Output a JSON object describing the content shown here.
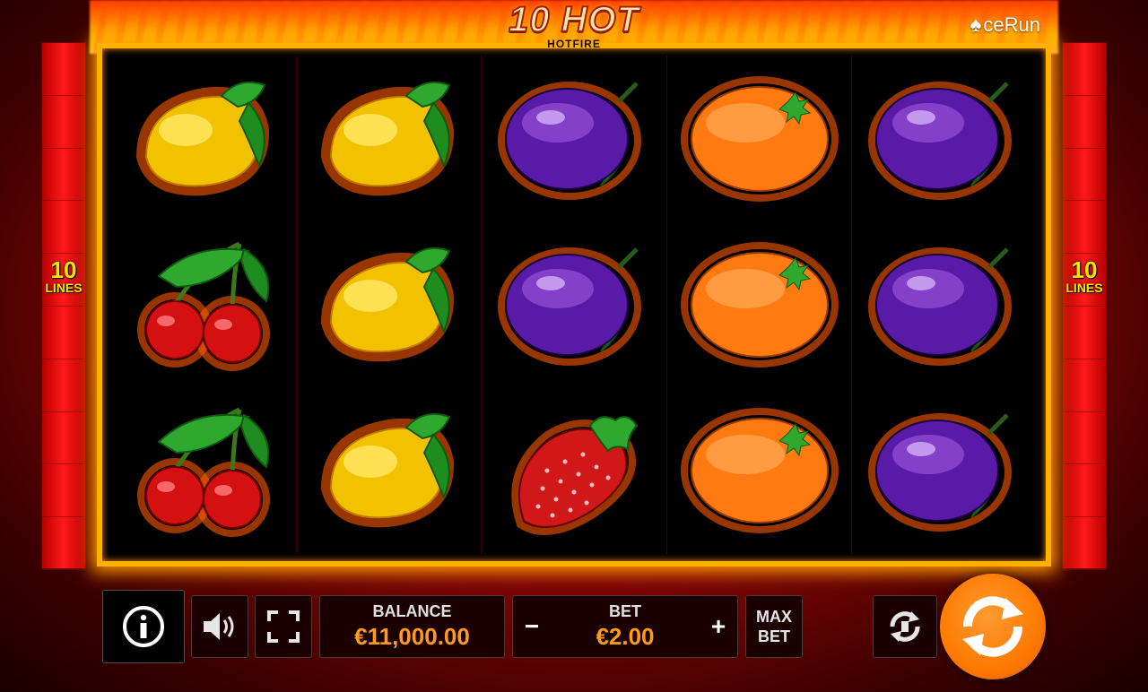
{
  "header": {
    "logo_main": "10 HOT",
    "logo_sub": "HOTFIRE",
    "brand": "AceRun",
    "brand_text": "ceRun"
  },
  "lines": {
    "count": "10",
    "label": "LINES"
  },
  "reels": [
    [
      "lemon-icon",
      "cherry-icon",
      "cherry-icon"
    ],
    [
      "lemon-icon",
      "lemon-icon",
      "lemon-icon"
    ],
    [
      "plum-icon",
      "plum-icon",
      "strawberry-icon"
    ],
    [
      "orange-icon",
      "orange-icon",
      "orange-icon"
    ],
    [
      "plum-icon",
      "plum-icon",
      "plum-icon"
    ]
  ],
  "controls": {
    "balance_label": "BALANCE",
    "balance_value": "€11,000.00",
    "bet_label": "BET",
    "bet_value": "€2.00",
    "minus": "−",
    "plus": "+",
    "maxbet_line1": "MAX",
    "maxbet_line2": "BET"
  },
  "colors": {
    "accent": "#ff9a1a",
    "frame": "#ffb000",
    "background": "#8a0606",
    "spin_button": "#ff7a00"
  }
}
